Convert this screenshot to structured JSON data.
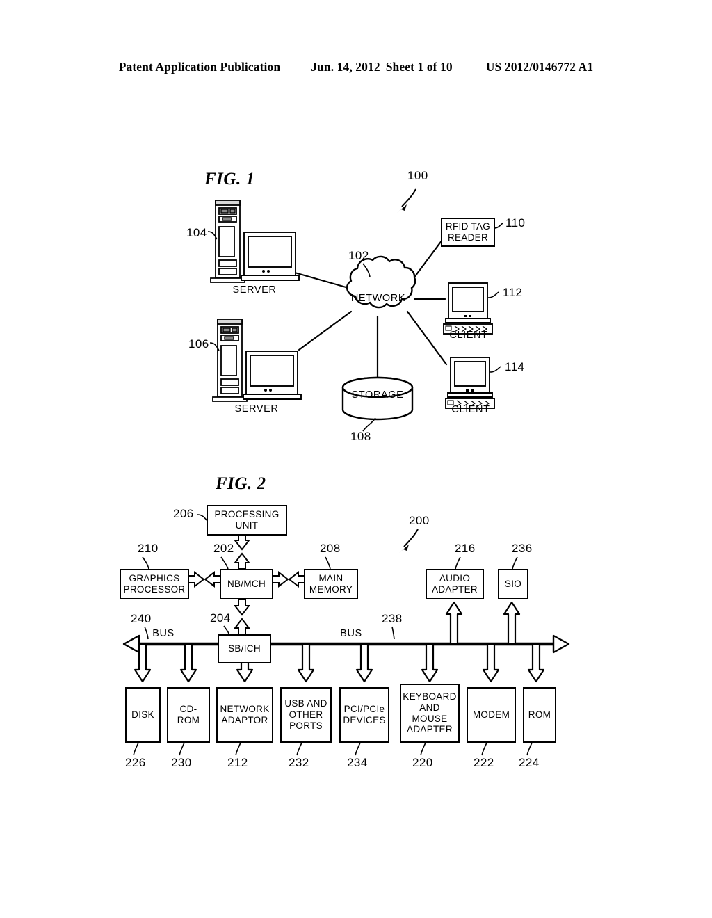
{
  "header": {
    "publication": "Patent Application Publication",
    "date": "Jun. 14, 2012",
    "sheet": "Sheet 1 of 10",
    "number": "US 2012/0146772 A1"
  },
  "figure1": {
    "title": "FIG. 1",
    "system_ref": "100",
    "nodes": {
      "network": {
        "label": "NETWORK",
        "ref": "102"
      },
      "storage": {
        "label": "STORAGE",
        "ref": "108"
      },
      "server_top": {
        "label": "SERVER",
        "ref": "104"
      },
      "server_bottom": {
        "label": "SERVER",
        "ref": "106"
      },
      "rfid_reader": {
        "label": "RFID TAG\nREADER",
        "ref": "110"
      },
      "client_top": {
        "label": "CLIENT",
        "ref": "112"
      },
      "client_bottom": {
        "label": "CLIENT",
        "ref": "114"
      }
    }
  },
  "figure2": {
    "title": "FIG. 2",
    "system_ref": "200",
    "bus_label_left": "BUS",
    "bus_label_right": "BUS",
    "bus_ref_left": "240",
    "bus_ref_right": "238",
    "blocks": {
      "processing_unit": {
        "label": "PROCESSING\nUNIT",
        "ref": "206"
      },
      "graphics_processor": {
        "label": "GRAPHICS\nPROCESSOR",
        "ref": "210"
      },
      "nb_mch": {
        "label": "NB/MCH",
        "ref": "202"
      },
      "main_memory": {
        "label": "MAIN\nMEMORY",
        "ref": "208"
      },
      "audio_adapter": {
        "label": "AUDIO\nADAPTER",
        "ref": "216"
      },
      "sio": {
        "label": "SIO",
        "ref": "236"
      },
      "sb_ich": {
        "label": "SB/ICH",
        "ref": "204"
      }
    },
    "devices": [
      {
        "label": "DISK",
        "ref": "226"
      },
      {
        "label": "CD-ROM",
        "ref": "230"
      },
      {
        "label": "NETWORK\nADAPTOR",
        "ref": "212"
      },
      {
        "label": "USB AND\nOTHER\nPORTS",
        "ref": "232"
      },
      {
        "label": "PCI/PCIe\nDEVICES",
        "ref": "234"
      },
      {
        "label": "KEYBOARD\nAND\nMOUSE\nADAPTER",
        "ref": "220"
      },
      {
        "label": "MODEM",
        "ref": "222"
      },
      {
        "label": "ROM",
        "ref": "224"
      }
    ]
  }
}
